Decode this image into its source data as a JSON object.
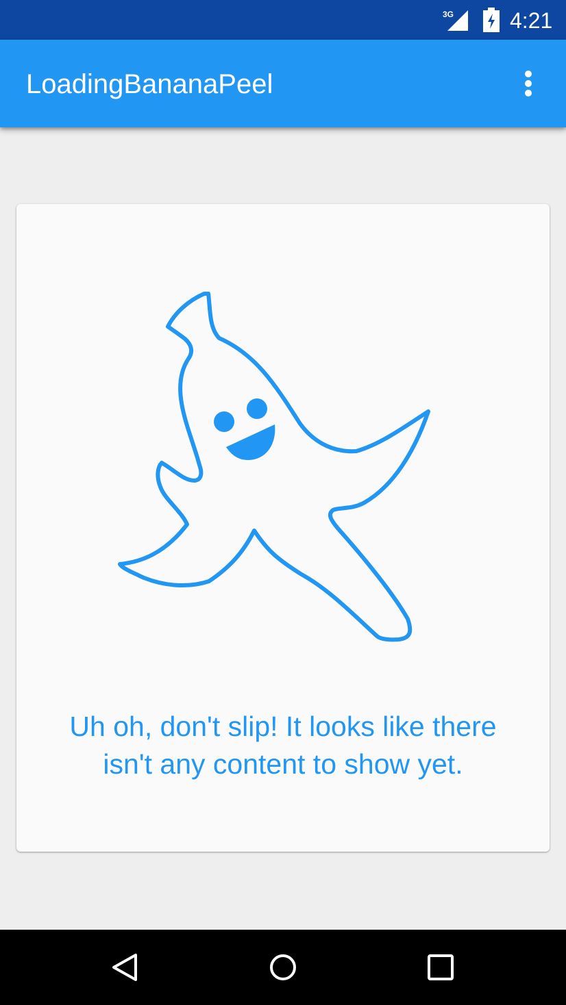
{
  "status_bar": {
    "network_label": "3G",
    "time": "4:21",
    "background_color": "#0d47a1"
  },
  "app_bar": {
    "title": "LoadingBananaPeel",
    "background_color": "#2196f3",
    "overflow_icon": "more-vert-icon"
  },
  "empty_state": {
    "illustration": "banana-peel-mascot",
    "message": "Uh oh, don't slip! It looks like there isn't any content to show yet.",
    "accent_color": "#2196f3"
  },
  "nav_bar": {
    "buttons": [
      {
        "name": "back",
        "icon": "back-triangle-icon"
      },
      {
        "name": "home",
        "icon": "home-circle-icon"
      },
      {
        "name": "recents",
        "icon": "recents-square-icon"
      }
    ]
  }
}
